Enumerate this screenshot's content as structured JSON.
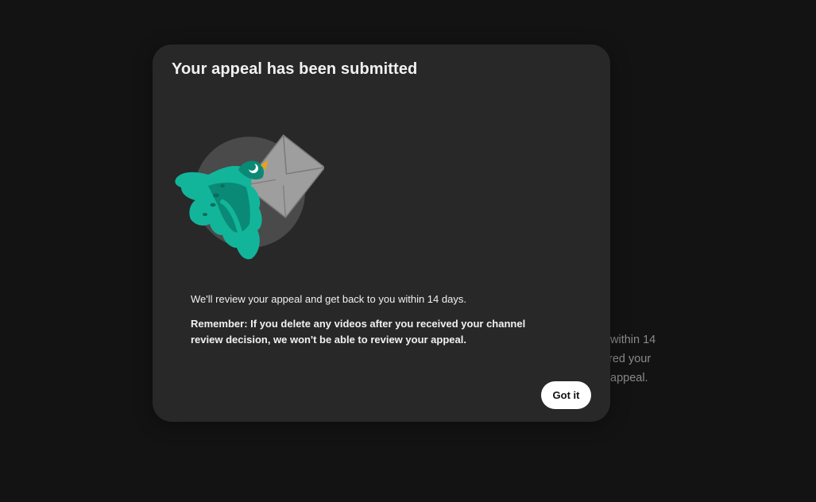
{
  "background": {
    "partial_text_lines": [
      "within 14",
      "red your",
      "appeal."
    ]
  },
  "dialog": {
    "title": "Your appeal has been submitted",
    "illustration_icon": "bird-carrying-envelope-icon",
    "message": "We'll review your appeal and get back to you within 14 days.",
    "warning": "Remember: If you delete any videos after you received your channel review decision, we won't be able to review your appeal.",
    "confirm_label": "Got it"
  },
  "colors": {
    "page_background": "#131313",
    "dialog_background": "#282828",
    "bird_primary": "#12b59a",
    "bird_dark": "#0a8a76",
    "envelope": "#9e9e9e",
    "beak": "#e8a317",
    "button_background": "#ffffff"
  }
}
